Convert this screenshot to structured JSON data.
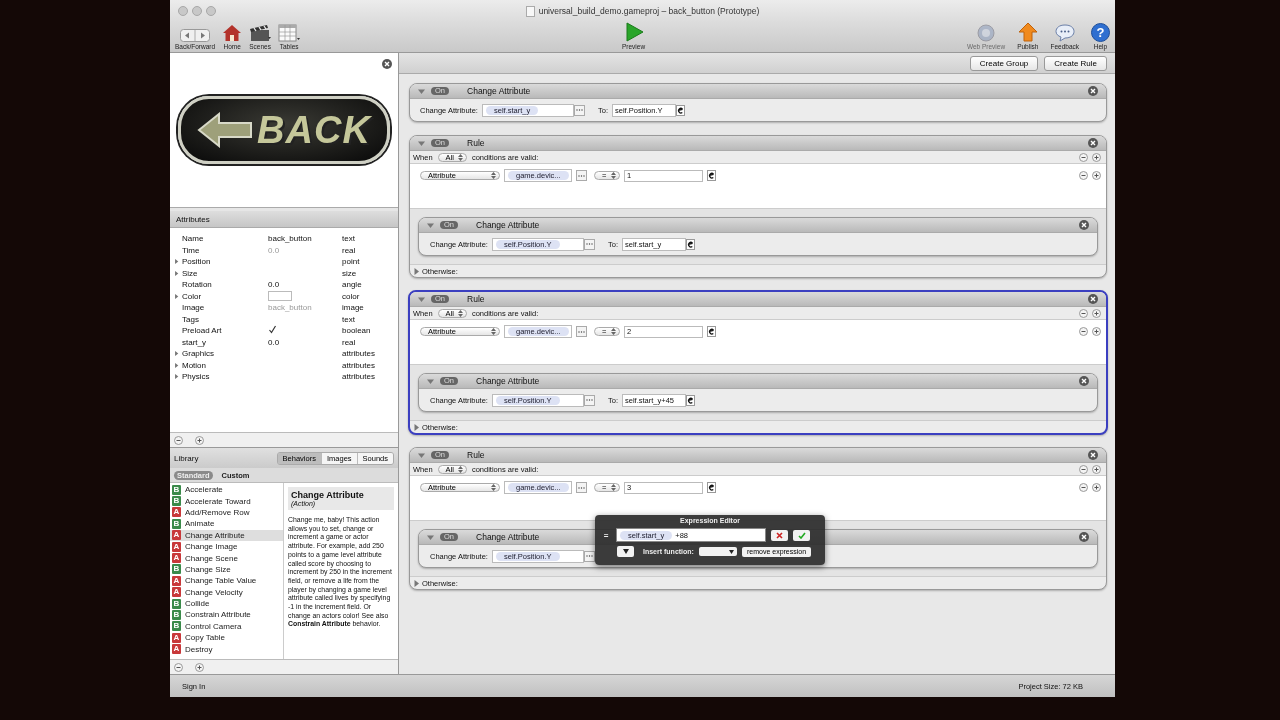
{
  "window": {
    "title": "universal_build_demo.gameproj – back_button (Prototype)"
  },
  "toolbar": {
    "left": [
      {
        "label": "Back/Forward",
        "kind": "nav"
      },
      {
        "label": "Home",
        "kind": "home"
      },
      {
        "label": "Scenes",
        "kind": "scenes"
      },
      {
        "label": "Tables",
        "kind": "tables"
      }
    ],
    "center": [
      {
        "label": "Preview",
        "kind": "preview"
      }
    ],
    "right": [
      {
        "label": "Web Preview",
        "kind": "web",
        "disabled": true
      },
      {
        "label": "Publish",
        "kind": "publish",
        "disabled": false
      },
      {
        "label": "Feedback",
        "kind": "feedback",
        "disabled": false
      },
      {
        "label": "Help",
        "kind": "help",
        "glyph": "?",
        "disabled": false
      }
    ]
  },
  "preview": {
    "image_text": "BACK"
  },
  "attributes": {
    "title": "Attributes",
    "rows": [
      {
        "name": "Name",
        "value": "back_button",
        "dim": false,
        "type": "text",
        "expandable": false,
        "kind": "text"
      },
      {
        "name": "Time",
        "value": "0.0",
        "dim": true,
        "type": "real",
        "expandable": false,
        "kind": "text"
      },
      {
        "name": "Position",
        "type": "point",
        "expandable": true,
        "kind": "text"
      },
      {
        "name": "Size",
        "type": "size",
        "expandable": true,
        "kind": "text"
      },
      {
        "name": "Rotation",
        "value": "0.0",
        "dim": false,
        "type": "angle",
        "expandable": false,
        "kind": "text"
      },
      {
        "name": "Color",
        "type": "color",
        "expandable": true,
        "kind": "swatch"
      },
      {
        "name": "Image",
        "value": "back_button",
        "dim": true,
        "type": "image",
        "expandable": false,
        "kind": "text"
      },
      {
        "name": "Tags",
        "type": "text",
        "expandable": false,
        "kind": "text"
      },
      {
        "name": "Preload Art",
        "type": "boolean",
        "expandable": false,
        "kind": "checkbox",
        "checked": true
      },
      {
        "name": "start_y",
        "value": "0.0",
        "dim": false,
        "type": "real",
        "expandable": false,
        "kind": "text"
      },
      {
        "name": "Graphics",
        "type": "attributes",
        "expandable": true,
        "kind": "text"
      },
      {
        "name": "Motion",
        "type": "attributes",
        "expandable": true,
        "kind": "text"
      },
      {
        "name": "Physics",
        "type": "attributes",
        "expandable": true,
        "kind": "text"
      }
    ]
  },
  "library": {
    "title": "Library",
    "tabs": [
      {
        "label": "Behaviors",
        "selected": true
      },
      {
        "label": "Images",
        "selected": false
      },
      {
        "label": "Sounds",
        "selected": false
      }
    ],
    "filters": [
      {
        "label": "Standard",
        "selected": true
      },
      {
        "label": "Custom",
        "selected": false
      }
    ],
    "items": [
      {
        "label": "Accelerate",
        "badge": "B",
        "selected": false
      },
      {
        "label": "Accelerate Toward",
        "badge": "B",
        "selected": false
      },
      {
        "label": "Add/Remove Row",
        "badge": "A",
        "selected": false
      },
      {
        "label": "Animate",
        "badge": "B",
        "selected": false
      },
      {
        "label": "Change Attribute",
        "badge": "A",
        "selected": true
      },
      {
        "label": "Change Image",
        "badge": "A",
        "selected": false
      },
      {
        "label": "Change Scene",
        "badge": "A",
        "selected": false
      },
      {
        "label": "Change Size",
        "badge": "B",
        "selected": false
      },
      {
        "label": "Change Table Value",
        "badge": "A",
        "selected": false
      },
      {
        "label": "Change Velocity",
        "badge": "A",
        "selected": false
      },
      {
        "label": "Collide",
        "badge": "B",
        "selected": false
      },
      {
        "label": "Constrain Attribute",
        "badge": "B",
        "selected": false
      },
      {
        "label": "Control Camera",
        "badge": "B",
        "selected": false
      },
      {
        "label": "Copy Table",
        "badge": "A",
        "selected": false
      },
      {
        "label": "Destroy",
        "badge": "A",
        "selected": false
      }
    ],
    "description": {
      "title": "Change Attribute",
      "subtitle": "(Action)",
      "body": "Change me, baby! This action allows you to set, change or increment a game or actor attribute. For example, add 250 points to a game level attribute called score by choosing to increment by 250 in the increment field, or remove a life from the player by changing a game level attribute called lives by specifying -1 in the increment field. Or change an actors color! See also **Constrain Attribute** behavior."
    }
  },
  "editor_toolbar": {
    "buttons": [
      "Create Group",
      "Create Rule"
    ]
  },
  "behaviors": [
    {
      "kind": "change_attribute",
      "toggle": "On",
      "title": "Change Attribute",
      "field_label": "Change Attribute:",
      "target": "self.start_y",
      "to_label": "To:",
      "to": "self.Position.Y"
    },
    {
      "kind": "rule",
      "selected": false,
      "toggle": "On",
      "title": "Rule",
      "when": "When",
      "match": "All",
      "match_suffix": "conditions are valid:",
      "condition": {
        "type": "Attribute",
        "attribute": "game.devic...",
        "operator": "=",
        "value": "1"
      },
      "actions": [
        {
          "kind": "change_attribute",
          "toggle": "On",
          "title": "Change Attribute",
          "field_label": "Change Attribute:",
          "target": "self.Position.Y",
          "to_label": "To:",
          "to": "self.start_y"
        }
      ],
      "otherwise": "Otherwise:"
    },
    {
      "kind": "rule",
      "selected": true,
      "toggle": "On",
      "title": "Rule",
      "when": "When",
      "match": "All",
      "match_suffix": "conditions are valid:",
      "condition": {
        "type": "Attribute",
        "attribute": "game.devic...",
        "operator": "=",
        "value": "2"
      },
      "actions": [
        {
          "kind": "change_attribute",
          "toggle": "On",
          "title": "Change Attribute",
          "field_label": "Change Attribute:",
          "target": "self.Position.Y",
          "to_label": "To:",
          "to": "self.start_y+45"
        }
      ],
      "otherwise": "Otherwise:"
    },
    {
      "kind": "rule",
      "selected": false,
      "toggle": "On",
      "title": "Rule",
      "when": "When",
      "match": "All",
      "match_suffix": "conditions are valid:",
      "condition": {
        "type": "Attribute",
        "attribute": "game.devic...",
        "operator": "=",
        "value": "3"
      },
      "actions": [
        {
          "kind": "change_attribute",
          "toggle": "On",
          "title": "Change Attribute",
          "field_label": "Change Attribute:",
          "target": "self.Position.Y"
        }
      ],
      "otherwise": "Otherwise:"
    }
  ],
  "expression_editor": {
    "title": "Expression Editor",
    "operator": "=",
    "token": "self.start_y",
    "text": "+88",
    "insert_label": "Insert function:",
    "remove_button": "remove expression"
  },
  "status_bar": {
    "left": "Sign In",
    "right": "Project Size: 72 KB"
  }
}
